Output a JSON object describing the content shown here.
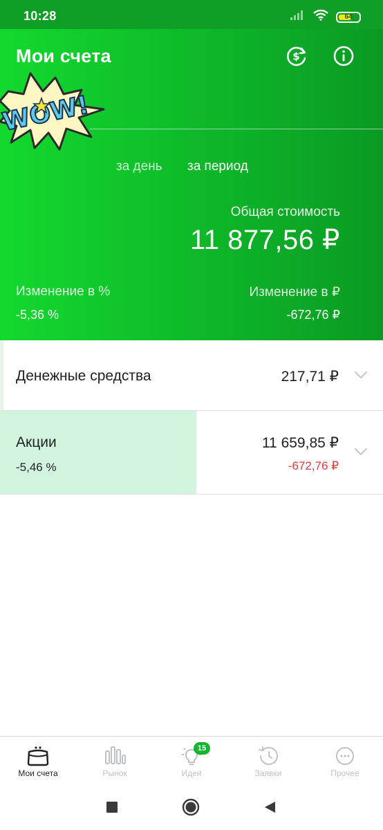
{
  "status_bar": {
    "time": "10:28",
    "battery_level": "64",
    "battery_fraction": 0.64,
    "icons": [
      "signal-icon",
      "wifi-icon",
      "battery-icon"
    ]
  },
  "header": {
    "title": "Мои счета",
    "sticker_text": "WOW!",
    "tabs": {
      "day": "за день",
      "period": "за период",
      "active": "period"
    },
    "total_label": "Общая стоимость",
    "total_value": "11 877,56 ₽",
    "change_pct_label": "Изменение в  %",
    "change_pct_value": "-5,36  %",
    "change_rub_label": "Изменение в ₽",
    "change_rub_value": "-672,76 ₽",
    "icons": [
      "currency-exchange-icon",
      "info-icon"
    ]
  },
  "accounts": [
    {
      "name": "Денежные средства",
      "amount": "217,71 ₽"
    },
    {
      "name": "Акции",
      "sub": "-5,46  %",
      "amount": "11 659,85 ₽",
      "change": "-672,76 ₽"
    }
  ],
  "bottom_nav": {
    "items": [
      {
        "label": "Мои счета",
        "icon": "wallet-icon",
        "active": true
      },
      {
        "label": "Рынок",
        "icon": "market-chart-icon"
      },
      {
        "label": "Идеи",
        "icon": "lightbulb-icon",
        "badge": "15"
      },
      {
        "label": "Заявки",
        "icon": "history-clock-icon"
      },
      {
        "label": "Прочее",
        "icon": "more-dots-icon"
      }
    ]
  },
  "colors": {
    "brand_green": "#13d92e",
    "negative_red": "#e53b3b",
    "highlight_mint": "#d2f4df",
    "badge_green": "#13b631"
  }
}
